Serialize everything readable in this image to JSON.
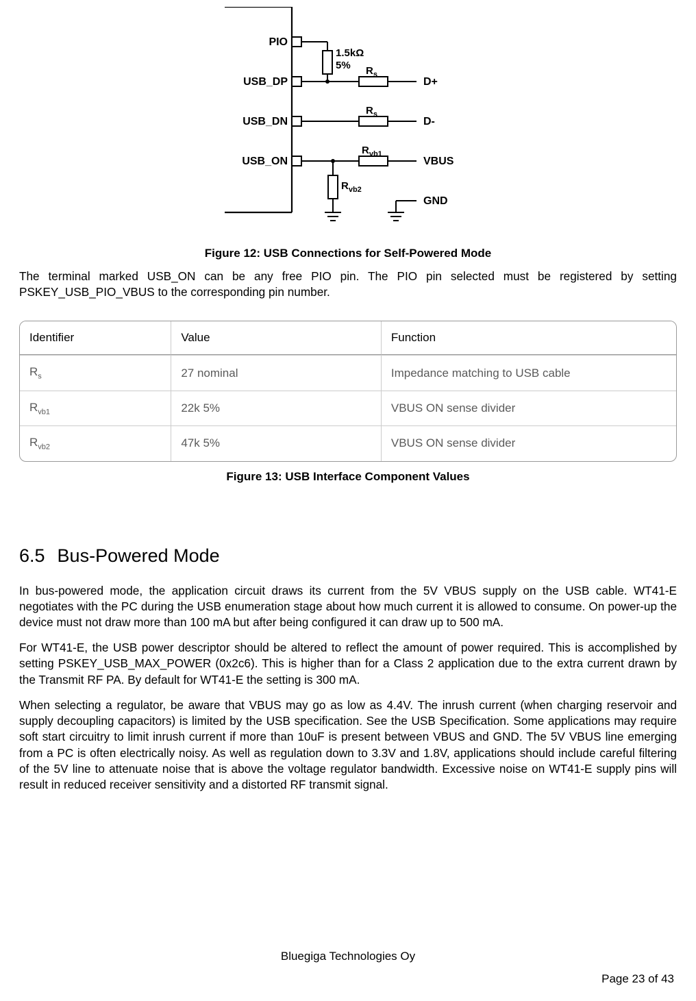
{
  "figure12": {
    "labels": {
      "pio": "PIO",
      "usb_dp": "USB_DP",
      "usb_dn": "USB_DN",
      "usb_on": "USB_ON",
      "r15k": "1.5kΩ",
      "pct5": "5%",
      "rs1": "R",
      "rs1_sub": "s",
      "rs2": "R",
      "rs2_sub": "s",
      "rvb1": "R",
      "rvb1_sub": "vb1",
      "rvb2": "R",
      "rvb2_sub": "vb2",
      "dplus": "D+",
      "dminus": "D-",
      "vbus": "VBUS",
      "gnd": "GND"
    },
    "caption": "Figure 12: USB Connections for Self-Powered Mode"
  },
  "para1": "The terminal marked USB_ON can be any free PIO pin. The PIO pin selected must be registered by setting PSKEY_USB_PIO_VBUS to the corresponding pin number.",
  "table": {
    "headers": {
      "identifier": "Identifier",
      "value": "Value",
      "function": "Function"
    },
    "rows": [
      {
        "id_text": "R",
        "id_sub": "s",
        "value": "27 nominal",
        "function": "Impedance matching to USB cable"
      },
      {
        "id_text": "R",
        "id_sub": "vb1",
        "value": "22k 5%",
        "function": "VBUS ON sense divider"
      },
      {
        "id_text": "R",
        "id_sub": "vb2",
        "value": "47k 5%",
        "function": "VBUS ON sense divider"
      }
    ]
  },
  "figure13_caption": "Figure 13: USB Interface Component Values",
  "section": {
    "num": "6.5",
    "title": "Bus-Powered Mode"
  },
  "para2": "In bus-powered mode, the application circuit draws its current from the 5V VBUS supply on the USB cable. WT41-E negotiates with the PC during the USB enumeration stage about how much current it is allowed to consume. On power-up the device must not draw more than 100 mA but after being configured it can draw up to 500 mA.",
  "para3": "For WT41-E, the USB power descriptor should be altered to reflect the amount of power required. This is accomplished by setting PSKEY_USB_MAX_POWER (0x2c6). This is higher than for a Class 2 application due to the extra current drawn by the Transmit RF PA. By default for WT41-E the setting is 300 mA.",
  "para4": "When selecting a regulator, be aware that VBUS may go as low as 4.4V. The inrush current (when charging reservoir and supply decoupling capacitors) is limited by the USB specification. See the USB Specification. Some applications may require soft start circuitry to limit inrush current if more than 10uF is present between VBUS and GND. The 5V VBUS line emerging from a PC is often electrically noisy. As well as regulation down to 3.3V and 1.8V, applications should include careful filtering of the 5V line to attenuate noise that is above the voltage regulator bandwidth. Excessive noise on WT41-E supply pins will result in reduced receiver sensitivity and a distorted RF transmit signal.",
  "footer": {
    "center": "Bluegiga Technologies Oy",
    "right": "Page 23 of 43"
  }
}
